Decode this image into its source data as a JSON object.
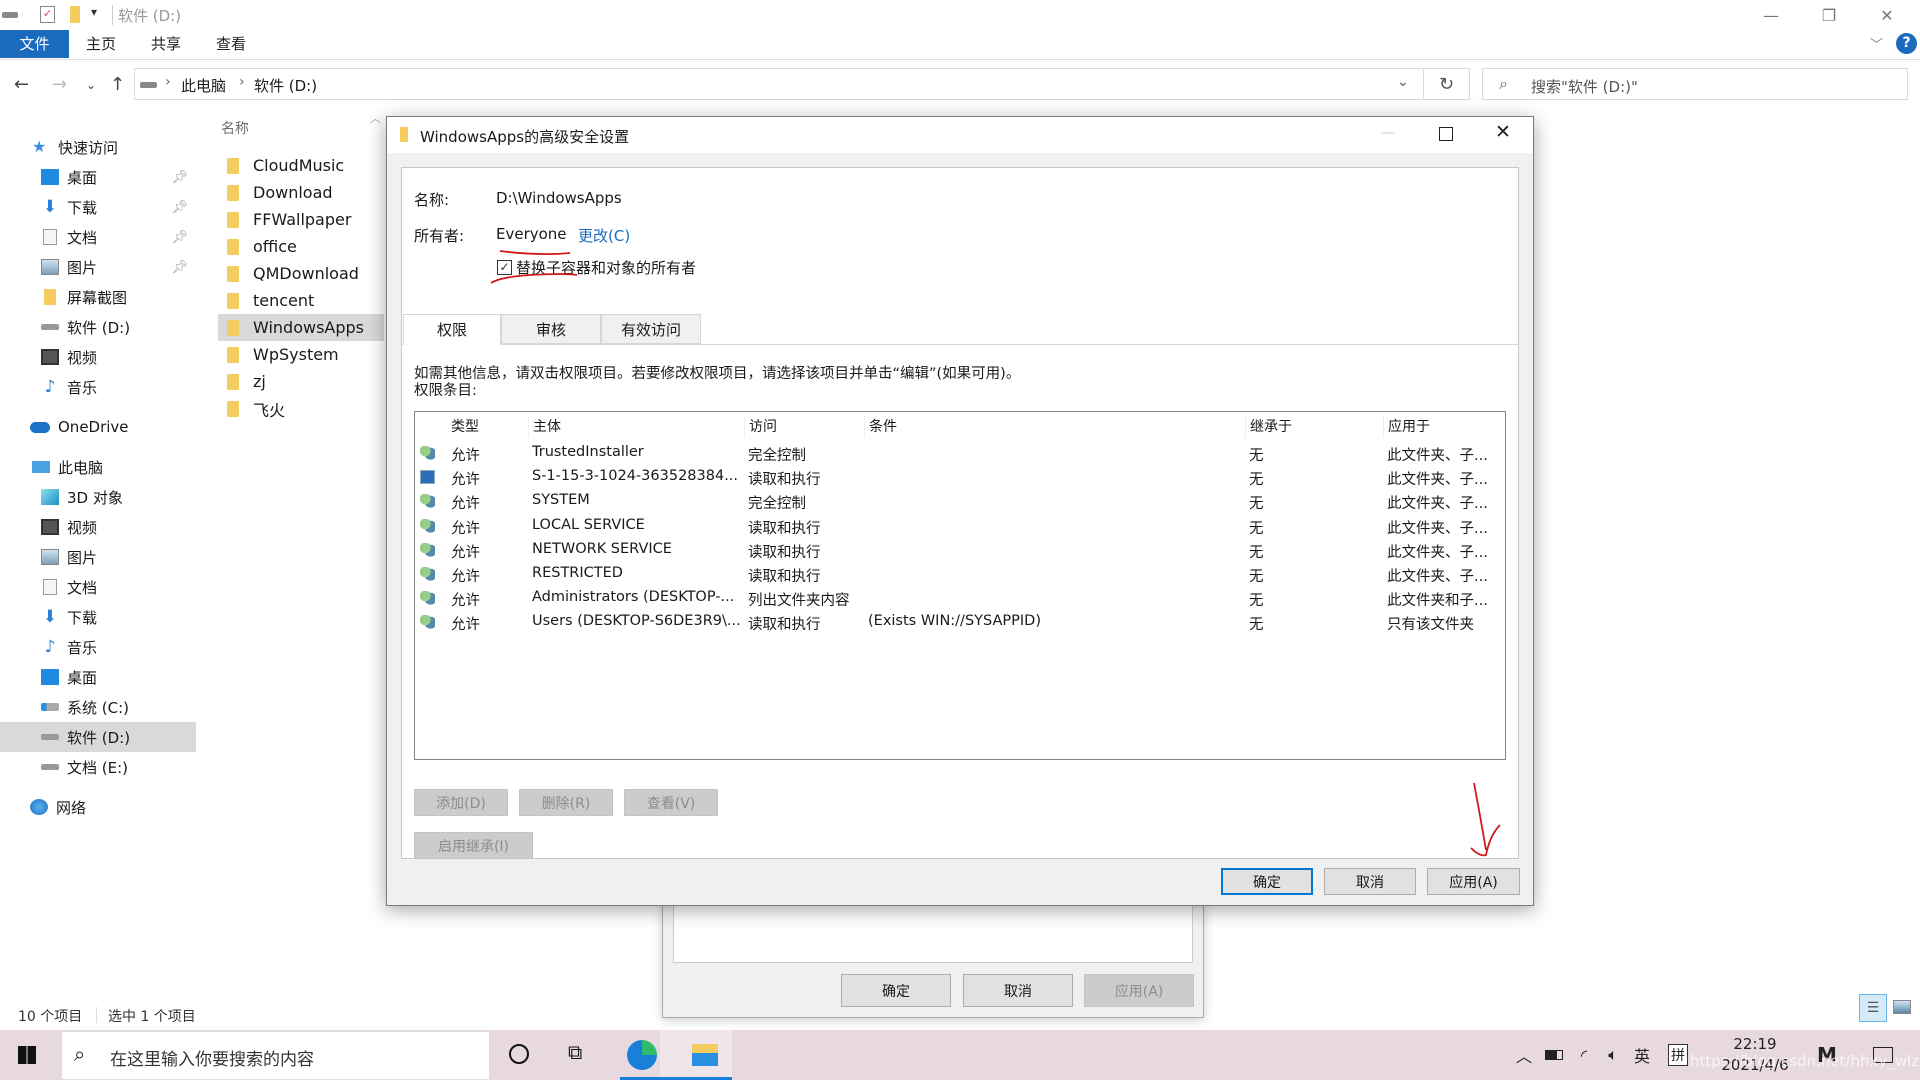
{
  "explorer": {
    "title": "软件 (D:)",
    "ribbon_tabs": [
      "文件",
      "主页",
      "共享",
      "查看"
    ],
    "breadcrumb": [
      "此电脑",
      "软件 (D:)"
    ],
    "search_placeholder": "搜索\"软件 (D:)\"",
    "column_header": "名称",
    "sidebar": {
      "quick_access": "快速访问",
      "quick_items": [
        {
          "label": "桌面",
          "icon": "desktop-icon",
          "pinned": true
        },
        {
          "label": "下载",
          "icon": "download-icon",
          "pinned": true
        },
        {
          "label": "文档",
          "icon": "document-icon",
          "pinned": true
        },
        {
          "label": "图片",
          "icon": "picture-icon",
          "pinned": true
        },
        {
          "label": "屏幕截图",
          "icon": "folder-icon",
          "pinned": false
        },
        {
          "label": "软件 (D:)",
          "icon": "drive-icon",
          "pinned": false
        },
        {
          "label": "视频",
          "icon": "video-icon",
          "pinned": false
        },
        {
          "label": "音乐",
          "icon": "music-icon",
          "pinned": false
        }
      ],
      "onedrive": "OneDrive",
      "this_pc": "此电脑",
      "pc_items": [
        {
          "label": "3D 对象",
          "icon": "3d-objects-icon"
        },
        {
          "label": "视频",
          "icon": "video-icon"
        },
        {
          "label": "图片",
          "icon": "picture-icon"
        },
        {
          "label": "文档",
          "icon": "document-icon"
        },
        {
          "label": "下载",
          "icon": "download-icon"
        },
        {
          "label": "音乐",
          "icon": "music-icon"
        },
        {
          "label": "桌面",
          "icon": "desktop-icon"
        },
        {
          "label": "系统 (C:)",
          "icon": "system-drive-icon"
        },
        {
          "label": "软件 (D:)",
          "icon": "drive-icon",
          "selected": true
        },
        {
          "label": "文档 (E:)",
          "icon": "drive-icon"
        }
      ],
      "network": "网络"
    },
    "files": [
      "CloudMusic",
      "Download",
      "FFWallpaper",
      "office",
      "QMDownload",
      "tencent",
      "WindowsApps",
      "WpSystem",
      "zj",
      "飞火"
    ],
    "selected_file": "WindowsApps",
    "status": {
      "count": "10 个项目",
      "selected": "选中 1 个项目"
    }
  },
  "dialog": {
    "title": "WindowsApps的高级安全设置",
    "name_label": "名称:",
    "name_value": "D:\\WindowsApps",
    "owner_label": "所有者:",
    "owner_value": "Everyone",
    "change_link": "更改(C)",
    "replace_owner_checkbox": {
      "label": "替换子容器和对象的所有者",
      "checked": true
    },
    "tabs": [
      "权限",
      "审核",
      "有效访问"
    ],
    "active_tab": "权限",
    "info_text": "如需其他信息，请双击权限项目。若要修改权限项目，请选择该项目并单击“编辑”(如果可用)。",
    "entries_label": "权限条目:",
    "columns": [
      "类型",
      "主体",
      "访问",
      "条件",
      "继承于",
      "应用于"
    ],
    "rows": [
      {
        "icon": "user-group-icon",
        "type": "允许",
        "principal": "TrustedInstaller",
        "access": "完全控制",
        "condition": "",
        "inherited": "无",
        "applies": "此文件夹、子..."
      },
      {
        "icon": "app-package-icon",
        "type": "允许",
        "principal": "S-1-15-3-1024-363528384...",
        "access": "读取和执行",
        "condition": "",
        "inherited": "无",
        "applies": "此文件夹、子..."
      },
      {
        "icon": "user-group-icon",
        "type": "允许",
        "principal": "SYSTEM",
        "access": "完全控制",
        "condition": "",
        "inherited": "无",
        "applies": "此文件夹、子..."
      },
      {
        "icon": "user-group-icon",
        "type": "允许",
        "principal": "LOCAL SERVICE",
        "access": "读取和执行",
        "condition": "",
        "inherited": "无",
        "applies": "此文件夹、子..."
      },
      {
        "icon": "user-group-icon",
        "type": "允许",
        "principal": "NETWORK SERVICE",
        "access": "读取和执行",
        "condition": "",
        "inherited": "无",
        "applies": "此文件夹、子..."
      },
      {
        "icon": "user-group-icon",
        "type": "允许",
        "principal": "RESTRICTED",
        "access": "读取和执行",
        "condition": "",
        "inherited": "无",
        "applies": "此文件夹、子..."
      },
      {
        "icon": "user-group-icon",
        "type": "允许",
        "principal": "Administrators (DESKTOP-...",
        "access": "列出文件夹内容",
        "condition": "",
        "inherited": "无",
        "applies": "此文件夹和子..."
      },
      {
        "icon": "user-group-icon",
        "type": "允许",
        "principal": "Users (DESKTOP-S6DE3R9\\...",
        "access": "读取和执行",
        "condition": "(Exists WIN://SYSAPPID)",
        "inherited": "无",
        "applies": "只有该文件夹"
      }
    ],
    "buttons": {
      "add": "添加(D)",
      "remove": "删除(R)",
      "view": "查看(V)",
      "enable_inheritance": "启用继承(I)",
      "ok": "确定",
      "cancel": "取消",
      "apply": "应用(A)"
    }
  },
  "bg_dialog": {
    "ok": "确定",
    "cancel": "取消",
    "apply": "应用(A)"
  },
  "taskbar": {
    "search_placeholder": "在这里输入你要搜索的内容",
    "ime_lang": "英",
    "ime_mode": "拼",
    "time": "22:19",
    "date": "2021/4/6",
    "watermark": "https://blog.csdn.net/hhxy_wlzx"
  },
  "colors": {
    "accent": "#1a6bbd",
    "annotation": "#d01818",
    "link": "#1a6bbd"
  }
}
